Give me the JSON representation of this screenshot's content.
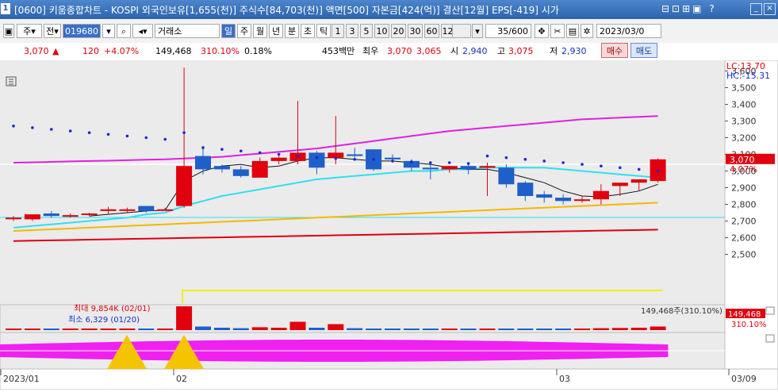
{
  "window": {
    "number": "1",
    "title": "[0600] 키움종합차트 - KOSPI 외국인보유[1,655(천)] 주식수[84,703(천)] 액면[500] 자본금[424(억)] 결산[12월] EPS[-419] 시가",
    "icons": "⊟⊡⊞▣ ?"
  },
  "toolbar": {
    "main_label": "주",
    "sub_label": "전",
    "stock_code": "019680",
    "market_select": "거래소",
    "periods": [
      "일",
      "주",
      "월",
      "년",
      "분",
      "초",
      "틱"
    ],
    "active_period": "일",
    "intervals": [
      "1",
      "3",
      "5",
      "10",
      "20",
      "30",
      "60",
      "120"
    ],
    "count": "35/600",
    "date": "2023/03/0"
  },
  "quote": {
    "price": "3,070",
    "arrow": "▲",
    "change": "120",
    "change_pct": "+4.07%",
    "volume": "149,468",
    "volume_ratio": "310.10%",
    "turnover": "0.18%",
    "amount": "453백만",
    "best_label": "최우",
    "best_ask": "3,070",
    "best_bid": "3,065",
    "open_label": "시",
    "open": "2,940",
    "high_label": "고",
    "high": "3,075",
    "low_label": "저",
    "low": "2,930",
    "buy_label": "매수",
    "sell_label": "매도"
  },
  "colors": {
    "up": "#e0000e",
    "down": "#1f5fc9",
    "ma5": "#111111",
    "ma20": "#2ee0f0",
    "ma60": "#f5b800",
    "ma120": "#e0000e",
    "envelope": "#e020e0",
    "sar": "#1a2ad8"
  },
  "chart_data": {
    "type": "candlestick",
    "y_axis": {
      "min": 2500,
      "max": 3600,
      "ticks": [
        "3,600",
        "3,500",
        "3,400",
        "3,300",
        "3,200",
        "3,100",
        "3,000",
        "2,900",
        "2,800",
        "2,700",
        "2,600",
        "2,500"
      ]
    },
    "x_labels": [
      "2023/01",
      "02",
      "03",
      "03/09"
    ],
    "lc_label": "LC:13.70",
    "hc_label": "HC:-15.31",
    "price_tag": "3,070",
    "price_tag_pct": "4.07%",
    "volume_tag": "149,468",
    "volume_tag_pct": "310.10%",
    "volume_annotation": "149,468주(310.10%)",
    "volume_max_label": "최대 9,854K (02/01)",
    "volume_min_label": "최소 6,329 (01/20)",
    "candles": [
      {
        "o": 2715,
        "h": 2730,
        "l": 2700,
        "c": 2720
      },
      {
        "o": 2710,
        "h": 2730,
        "l": 2700,
        "c": 2740
      },
      {
        "o": 2745,
        "h": 2760,
        "l": 2720,
        "c": 2730
      },
      {
        "o": 2735,
        "h": 2745,
        "l": 2720,
        "c": 2735
      },
      {
        "o": 2740,
        "h": 2750,
        "l": 2730,
        "c": 2745
      },
      {
        "o": 2760,
        "h": 2785,
        "l": 2740,
        "c": 2770
      },
      {
        "o": 2765,
        "h": 2780,
        "l": 2750,
        "c": 2770
      },
      {
        "o": 2790,
        "h": 2790,
        "l": 2750,
        "c": 2760
      },
      {
        "o": 2770,
        "h": 2780,
        "l": 2760,
        "c": 2770
      },
      {
        "o": 2790,
        "h": 3620,
        "l": 2780,
        "c": 3030
      },
      {
        "o": 3090,
        "h": 3140,
        "l": 2980,
        "c": 3010
      },
      {
        "o": 3030,
        "h": 3040,
        "l": 2990,
        "c": 3010
      },
      {
        "o": 3010,
        "h": 3030,
        "l": 2960,
        "c": 2970
      },
      {
        "o": 2960,
        "h": 3080,
        "l": 2960,
        "c": 3060
      },
      {
        "o": 3060,
        "h": 3090,
        "l": 3040,
        "c": 3080
      },
      {
        "o": 3060,
        "h": 3420,
        "l": 3040,
        "c": 3110
      },
      {
        "o": 3110,
        "h": 3120,
        "l": 2980,
        "c": 3020
      },
      {
        "o": 3080,
        "h": 3330,
        "l": 3040,
        "c": 3110
      },
      {
        "o": 3100,
        "h": 3140,
        "l": 3080,
        "c": 3090
      },
      {
        "o": 3130,
        "h": 3130,
        "l": 3000,
        "c": 3010
      },
      {
        "o": 3080,
        "h": 3100,
        "l": 3060,
        "c": 3070
      },
      {
        "o": 3060,
        "h": 3070,
        "l": 3000,
        "c": 3020
      },
      {
        "o": 3020,
        "h": 3040,
        "l": 2950,
        "c": 3010
      },
      {
        "o": 3010,
        "h": 3030,
        "l": 2990,
        "c": 3030
      },
      {
        "o": 3030,
        "h": 3040,
        "l": 2980,
        "c": 3010
      },
      {
        "o": 3020,
        "h": 3050,
        "l": 2850,
        "c": 3030
      },
      {
        "o": 3020,
        "h": 3040,
        "l": 2900,
        "c": 2920
      },
      {
        "o": 2930,
        "h": 2940,
        "l": 2820,
        "c": 2850
      },
      {
        "o": 2860,
        "h": 2880,
        "l": 2810,
        "c": 2840
      },
      {
        "o": 2840,
        "h": 2860,
        "l": 2800,
        "c": 2820
      },
      {
        "o": 2830,
        "h": 2850,
        "l": 2810,
        "c": 2830
      },
      {
        "o": 2830,
        "h": 2920,
        "l": 2800,
        "c": 2880
      },
      {
        "o": 2910,
        "h": 2930,
        "l": 2850,
        "c": 2930
      },
      {
        "o": 2930,
        "h": 2940,
        "l": 2880,
        "c": 2950
      },
      {
        "o": 2940,
        "h": 3075,
        "l": 2930,
        "c": 3070
      }
    ],
    "ma5": [
      null,
      null,
      null,
      null,
      2730,
      2740,
      2750,
      2760,
      2765,
      2940,
      3000,
      3030,
      3040,
      3020,
      3030,
      3060,
      3080,
      3080,
      3070,
      3060,
      3060,
      3050,
      3040,
      3020,
      3010,
      3010,
      2990,
      2960,
      2930,
      2880,
      2850,
      2845,
      2860,
      2880,
      2920
    ],
    "ma20": [
      2660,
      2670,
      2680,
      2690,
      2700,
      2710,
      2720,
      2740,
      2750,
      2790,
      2820,
      2850,
      2870,
      2890,
      2910,
      2930,
      2950,
      2960,
      2970,
      2980,
      2990,
      3000,
      3000,
      3010,
      3010,
      3020,
      3020,
      3020,
      3020,
      3010,
      3000,
      2990,
      2980,
      2970,
      2960
    ],
    "ma60": [
      2640,
      2645,
      2650,
      2655,
      2660,
      2665,
      2670,
      2675,
      2680,
      2685,
      2690,
      2695,
      2700,
      2705,
      2710,
      2715,
      2720,
      2725,
      2730,
      2735,
      2740,
      2745,
      2750,
      2755,
      2760,
      2765,
      2770,
      2775,
      2780,
      2785,
      2790,
      2795,
      2800,
      2805,
      2810
    ],
    "ma120": [
      2580,
      2582,
      2584,
      2586,
      2588,
      2590,
      2592,
      2594,
      2596,
      2598,
      2600,
      2602,
      2604,
      2606,
      2608,
      2610,
      2612,
      2614,
      2616,
      2618,
      2620,
      2622,
      2624,
      2626,
      2628,
      2630,
      2632,
      2634,
      2636,
      2638,
      2640,
      2642,
      2644,
      2646,
      2648
    ],
    "envelope": [
      3050,
      3052,
      3055,
      3058,
      3060,
      3062,
      3065,
      3068,
      3070,
      3075,
      3080,
      3085,
      3095,
      3105,
      3115,
      3125,
      3135,
      3150,
      3165,
      3180,
      3195,
      3210,
      3225,
      3240,
      3250,
      3260,
      3270,
      3280,
      3290,
      3300,
      3310,
      3315,
      3320,
      3325,
      3330
    ],
    "sar": [
      3270,
      3260,
      3250,
      3240,
      3230,
      3220,
      3210,
      3200,
      3190,
      3230,
      3140,
      3130,
      3120,
      3110,
      3100,
      3090,
      3080,
      3075,
      3070,
      3070,
      3060,
      3055,
      3050,
      3050,
      3045,
      3090,
      3080,
      3070,
      3060,
      3050,
      3040,
      3030,
      3020,
      3010,
      3000
    ],
    "volume": [
      0.05,
      0.03,
      0.05,
      0.03,
      0.04,
      0.06,
      0.05,
      0.04,
      0.04,
      1.0,
      0.15,
      0.1,
      0.08,
      0.12,
      0.1,
      0.35,
      0.1,
      0.25,
      0.08,
      0.06,
      0.05,
      0.06,
      0.05,
      0.05,
      0.04,
      0.06,
      0.05,
      0.06,
      0.05,
      0.04,
      0.05,
      0.08,
      0.09,
      0.1,
      0.15
    ]
  }
}
